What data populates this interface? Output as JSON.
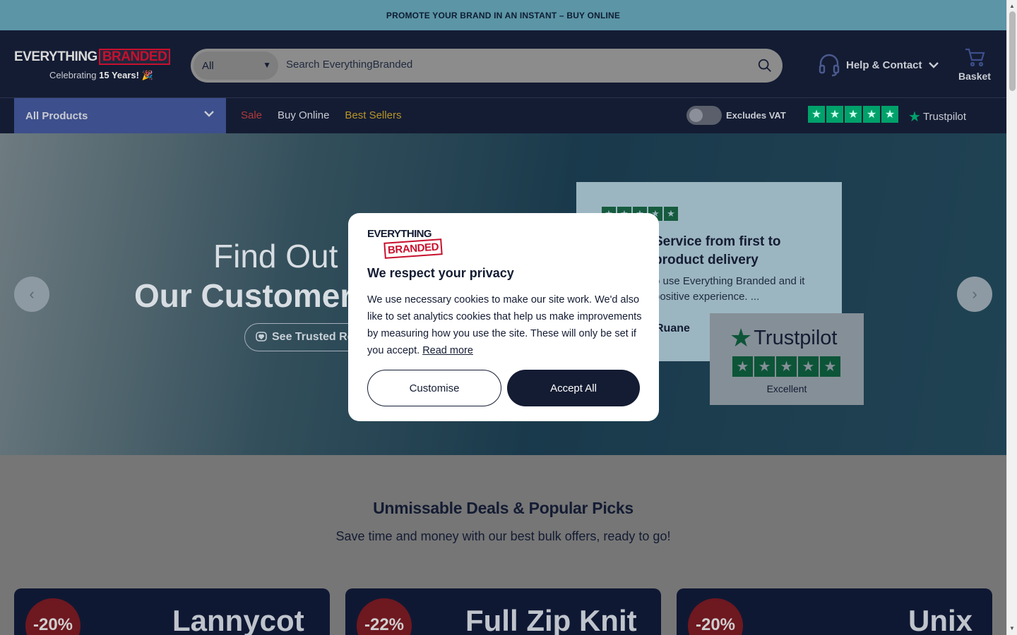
{
  "promo": {
    "text": "PROMOTE YOUR BRAND IN AN INSTANT – BUY ONLINE"
  },
  "header": {
    "logo": {
      "part1": "EVERYTHING",
      "part2": "BRANDED",
      "tag_prefix": "Celebrating ",
      "tag_bold": "15 Years!",
      "tag_emoji": " 🎉"
    },
    "search": {
      "category": "All",
      "placeholder": "Search EverythingBranded"
    },
    "help_label": "Help & Contact",
    "basket_label": "Basket"
  },
  "nav": {
    "all_products": "All Products",
    "links": {
      "sale": "Sale",
      "buy_online": "Buy Online",
      "best_sellers": "Best Sellers"
    },
    "vat_label": "Excludes VAT",
    "trustpilot": "Trustpilot"
  },
  "hero": {
    "title_line1": "Find Out",
    "title_line2": "Our Customer",
    "button_label": "See Trusted Rev",
    "review": {
      "title": "Service from first to product delivery",
      "body": "o use Everything Branded and it positive experience. ...",
      "name": "Ruane"
    },
    "badge": {
      "logo": "Trustpilot",
      "rating_label": "Excellent"
    }
  },
  "deals": {
    "title": "Unmissable Deals & Popular Picks",
    "subtitle": "Save time and money with our best bulk offers, ready to go!",
    "cards": [
      {
        "discount": "-20%",
        "name": "Lannycot"
      },
      {
        "discount": "-22%",
        "name": "Full Zip Knit"
      },
      {
        "discount": "-20%",
        "name": "Unix"
      }
    ]
  },
  "cookie_modal": {
    "logo_top": "EVERYTHING",
    "logo_bottom": "BRANDED",
    "title": "We respect your privacy",
    "text": "We use necessary cookies to make our site work. We'd also like to set analytics cookies that help us make improvements by measuring how you use the site. These will only be set if you accept. ",
    "read_more": "Read more",
    "customise": "Customise",
    "accept_all": "Accept All"
  },
  "colors": {
    "navy": "#141c33",
    "brand_red": "#c8102e",
    "trustpilot_green": "#00a16a",
    "promo": "#5b95a6"
  }
}
